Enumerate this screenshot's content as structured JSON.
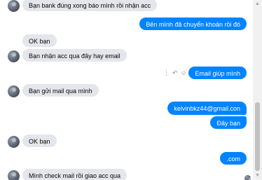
{
  "messages": [
    {
      "side": "in",
      "text": "Bạn bank đúng xong báo mình rồi nhận acc"
    },
    {
      "side": "out",
      "text": "Bên mình đã chuyển khoản rồi đó"
    },
    {
      "side": "in",
      "text": "OK bạn"
    },
    {
      "side": "in",
      "text": "Bạn nhận acc qua đây hay email"
    },
    {
      "side": "out",
      "text": "Email giúp mình"
    },
    {
      "side": "in",
      "text": "Bạn gửi mail qua mình"
    },
    {
      "side": "out",
      "text": "kelvinbkz44@gmail.con"
    },
    {
      "side": "out",
      "text": "Đây bạn"
    },
    {
      "side": "in",
      "text": "OK bạn"
    },
    {
      "side": "out",
      "text": ".com"
    },
    {
      "side": "in",
      "text": "Mình check mail rồi giao acc qua"
    }
  ],
  "actions": {
    "more_glyph": "⋮",
    "reply_glyph": "↶",
    "react_glyph": "☺",
    "icons": [
      "more-vertical-icon",
      "reply-icon",
      "reaction-icon"
    ]
  },
  "scrollbar": {
    "up_glyph": "▲",
    "down_glyph": "▼"
  },
  "colors": {
    "outgoing_bubble": "#0084ff",
    "incoming_bubble": "#e4e6eb"
  }
}
